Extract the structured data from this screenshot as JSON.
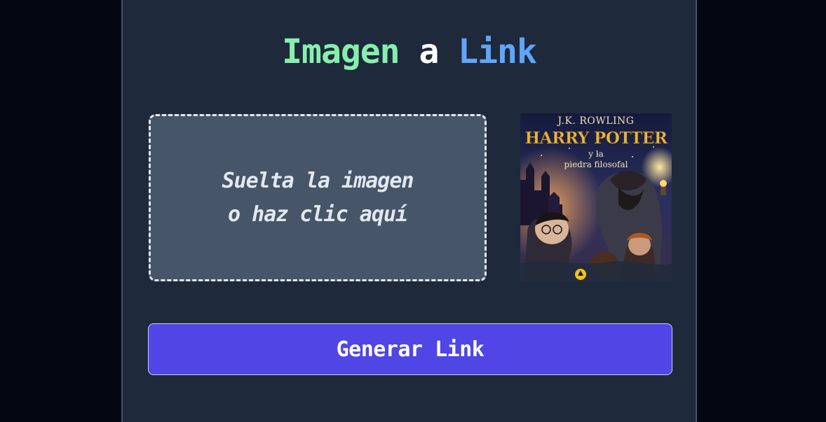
{
  "theme": {
    "title_color_1": "#86efac",
    "title_color_2": "#ffffff",
    "title_color_3": "#60a5fa",
    "button_color": "#4f46e5",
    "card_color": "#1e293b",
    "dropzone_color": "#475569"
  },
  "header": {
    "title_word_1": "Imagen",
    "title_word_2": "a",
    "title_word_3": "Link"
  },
  "dropzone": {
    "line_1": "Suelta la imagen",
    "line_2": "o haz clic aquí"
  },
  "preview": {
    "author": "J.K. ROWLING",
    "title": "HARRY POTTER",
    "subtitle_1": "y la",
    "subtitle_2": "piedra filosofal"
  },
  "actions": {
    "generate_label": "Generar Link"
  }
}
